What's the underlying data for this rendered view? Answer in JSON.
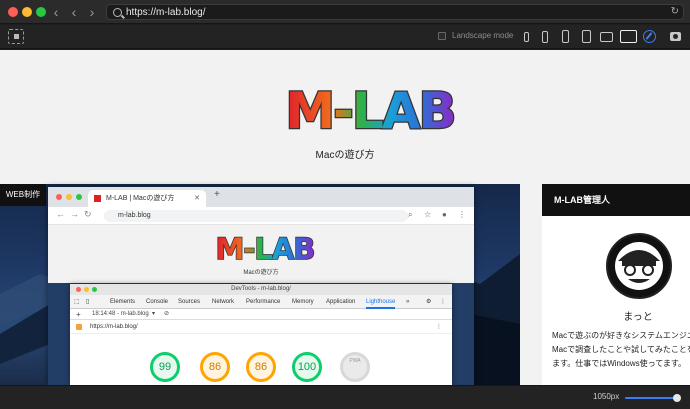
{
  "browser": {
    "url": "https://m-lab.blog/"
  },
  "toolbar": {
    "landscape_label": "Landscape mode"
  },
  "site": {
    "logo_text": "M-LAB",
    "tagline": "Macの遊び方",
    "hero_label": "WEB制作",
    "colors": {
      "accent_blue": "#3b7cf4",
      "header_black": "#111111"
    }
  },
  "screenshot": {
    "tab_title": "M-LAB | Macの遊び方",
    "omnibox": "m-lab.blog",
    "devtools": {
      "title": "DevTools - m-lab.blog/",
      "tabs": [
        "Elements",
        "Console",
        "Sources",
        "Network",
        "Performance",
        "Memory",
        "Application",
        "Lighthouse"
      ],
      "active_tab": "Lighthouse",
      "report_time": "18:14:48 - m-lab.blog",
      "report_url": "https://m-lab.blog/",
      "scores": [
        {
          "value": "99",
          "status": "green"
        },
        {
          "value": "86",
          "status": "orange"
        },
        {
          "value": "86",
          "status": "orange"
        },
        {
          "value": "100",
          "status": "green"
        },
        {
          "value": "PWA",
          "status": "gray"
        }
      ]
    }
  },
  "sidebar": {
    "heading": "M-LAB管理人",
    "name": "まっと",
    "bio": [
      "Macで遊ぶのが好きなシステムエンジニ",
      "Macで調査したことや試してみたことを",
      "ます。仕事ではWindows使ってます。"
    ]
  },
  "status": {
    "width_label": "1050px",
    "width_fraction": 0.92
  }
}
